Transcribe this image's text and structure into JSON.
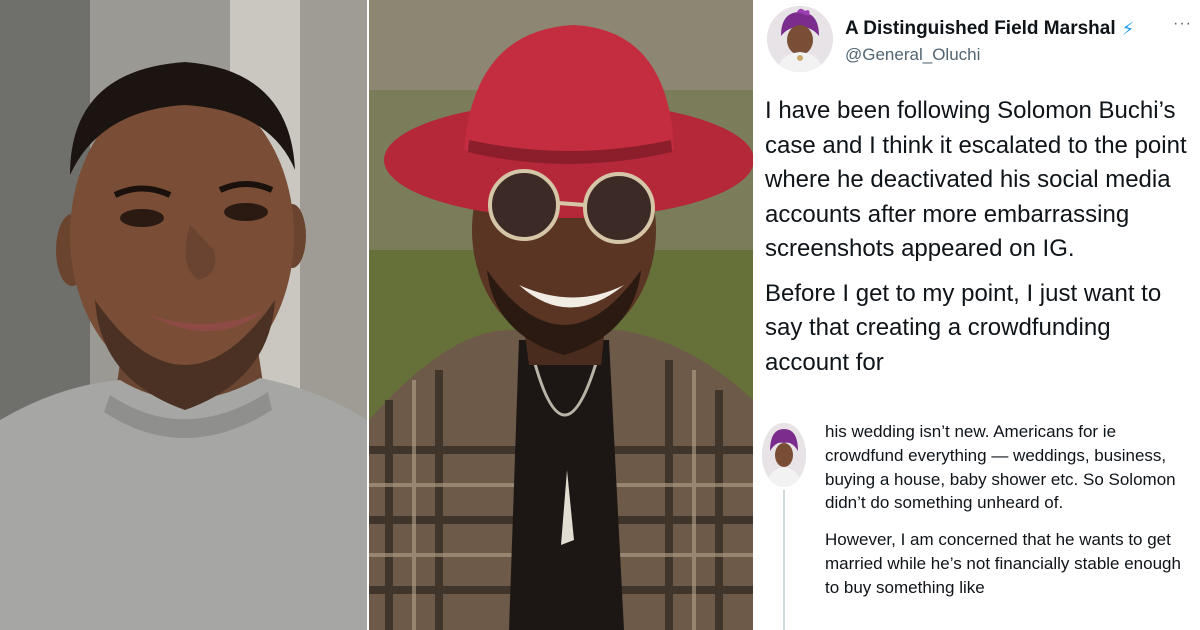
{
  "photos": [
    {
      "name": "portrait-smiling-grey-sweater"
    },
    {
      "name": "portrait-red-hat-sunglasses-plaid-shirt"
    }
  ],
  "tweet": {
    "display_name": "A Distinguished Field Marshal",
    "verified_glyph": "⚡",
    "handle": "@General_Oluchi",
    "more_glyph": "···",
    "paragraphs": [
      "I have been following Solomon Buchi’s case and I think it escalated to the point where he deactivated his social media accounts after more embarrassing screenshots appeared on IG.",
      "Before I get to my point, I just want to say that creating a crowdfunding account for"
    ]
  },
  "reply": {
    "paragraphs": [
      "his wedding isn’t new. Americans for ie crowdfund everything — weddings, business, buying a house, baby shower etc. So Solomon didn’t do something unheard of.",
      "However, I am concerned that he wants to get married while he’s not financially stable enough to buy something like"
    ]
  },
  "colors": {
    "text_primary": "#0f1419",
    "text_secondary": "#536471",
    "verified": "#1d9bf0",
    "hat_red": "#c42d3f",
    "thread_line": "#cfd9de"
  }
}
